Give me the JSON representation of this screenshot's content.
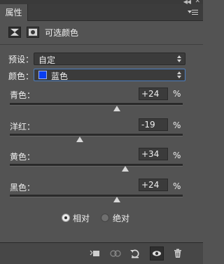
{
  "panel": {
    "tab_title": "属性"
  },
  "adjustment": {
    "title": "可选颜色",
    "icons": [
      "selective-color-icon",
      "mask-icon"
    ]
  },
  "preset": {
    "label": "预设：",
    "value": "自定"
  },
  "colors": {
    "label": "颜色：",
    "value": "蓝色",
    "swatch_color": "#0a3ef0"
  },
  "sliders": [
    {
      "label": "青色：",
      "value": "+24",
      "unit": "%",
      "level": 0.62
    },
    {
      "label": "洋红：",
      "value": "-19",
      "unit": "%",
      "level": 0.405
    },
    {
      "label": "黄色：",
      "value": "+34",
      "unit": "%",
      "level": 0.67
    },
    {
      "label": "黑色：",
      "value": "+24",
      "unit": "%",
      "level": 0.62
    }
  ],
  "method": {
    "relative": "相对",
    "absolute": "绝对",
    "selected": "relative"
  },
  "footer_icons": [
    "clip-to-layer-icon",
    "view-previous-state-icon",
    "reset-icon",
    "visibility-eye-icon",
    "trash-icon"
  ]
}
